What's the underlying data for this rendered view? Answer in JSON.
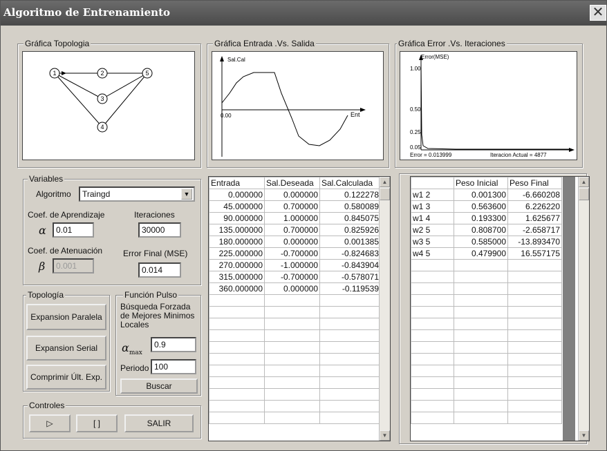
{
  "window": {
    "title": "Algoritmo de Entrenamiento",
    "close_glyph": "✕"
  },
  "topology": {
    "legend": "Gráfica Topologia",
    "nodes": [
      "1",
      "2",
      "3",
      "4",
      "5"
    ]
  },
  "io_chart": {
    "legend": "Gráfica Entrada .Vs. Salida",
    "ylabel": "Sal.Cal",
    "xlabel": "Ent",
    "origin_label": "0.00"
  },
  "error_chart": {
    "legend": "Gráfica Error .Vs. Iteraciones",
    "ylabel": "Error(MSE)",
    "ticks": [
      "1.00",
      "0.50",
      "0.25",
      "0.05"
    ],
    "error_text": "Error = 0.013999",
    "iter_text": "Iteracion Actual = 4877"
  },
  "variables": {
    "legend": "Variables",
    "algoritmo_label": "Algoritmo",
    "algoritmo_value": "Traingd",
    "coef_aprendizaje_label": "Coef. de Aprendizaje",
    "alpha_symbol": "α",
    "alpha_value": "0.01",
    "iteraciones_label": "Iteraciones",
    "iteraciones_value": "30000",
    "coef_atenuacion_label": "Coef. de Atenuación",
    "beta_symbol": "β",
    "beta_value": "0.001",
    "error_final_label": "Error Final (MSE)",
    "error_final_value": "0.014"
  },
  "topologia": {
    "legend": "Topología",
    "expansion_paralela": "Expansion Paralela",
    "expansion_serial": "Expansion Serial",
    "comprimir": "Comprimir Últ. Exp."
  },
  "funcion_pulso": {
    "legend": "Función Pulso",
    "description": "Búsqueda Forzada de Mejores Minimos Locales",
    "alpha_max_value": "0.9",
    "periodo_label": "Periodo",
    "periodo_value": "100",
    "buscar": "Buscar"
  },
  "controles": {
    "legend": "Controles",
    "play": "▷",
    "stop": "[ ]",
    "salir": "SALIR"
  },
  "io_table": {
    "headers": [
      "Entrada",
      "Sal.Deseada",
      "Sal.Calculada"
    ],
    "rows": [
      [
        "0.000000",
        "0.000000",
        "0.122278"
      ],
      [
        "45.000000",
        "0.700000",
        "0.580089"
      ],
      [
        "90.000000",
        "1.000000",
        "0.845075"
      ],
      [
        "135.000000",
        "0.700000",
        "0.825926"
      ],
      [
        "180.000000",
        "0.000000",
        "0.001385"
      ],
      [
        "225.000000",
        "-0.700000",
        "-0.824683"
      ],
      [
        "270.000000",
        "-1.000000",
        "-0.843904"
      ],
      [
        "315.000000",
        "-0.700000",
        "-0.578071"
      ],
      [
        "360.000000",
        "0.000000",
        "-0.119539"
      ]
    ]
  },
  "weights_table": {
    "headers": [
      "",
      "Peso Inicial",
      "Peso Final"
    ],
    "rows": [
      [
        "w1 2",
        "0.001300",
        "-6.660208"
      ],
      [
        "w1 3",
        "0.563600",
        "6.226220"
      ],
      [
        "w1 4",
        "0.193300",
        "1.625677"
      ],
      [
        "w2 5",
        "0.808700",
        "-2.658717"
      ],
      [
        "w3 5",
        "0.585000",
        "-13.893470"
      ],
      [
        "w4 5",
        "0.479900",
        "16.557175"
      ]
    ]
  }
}
